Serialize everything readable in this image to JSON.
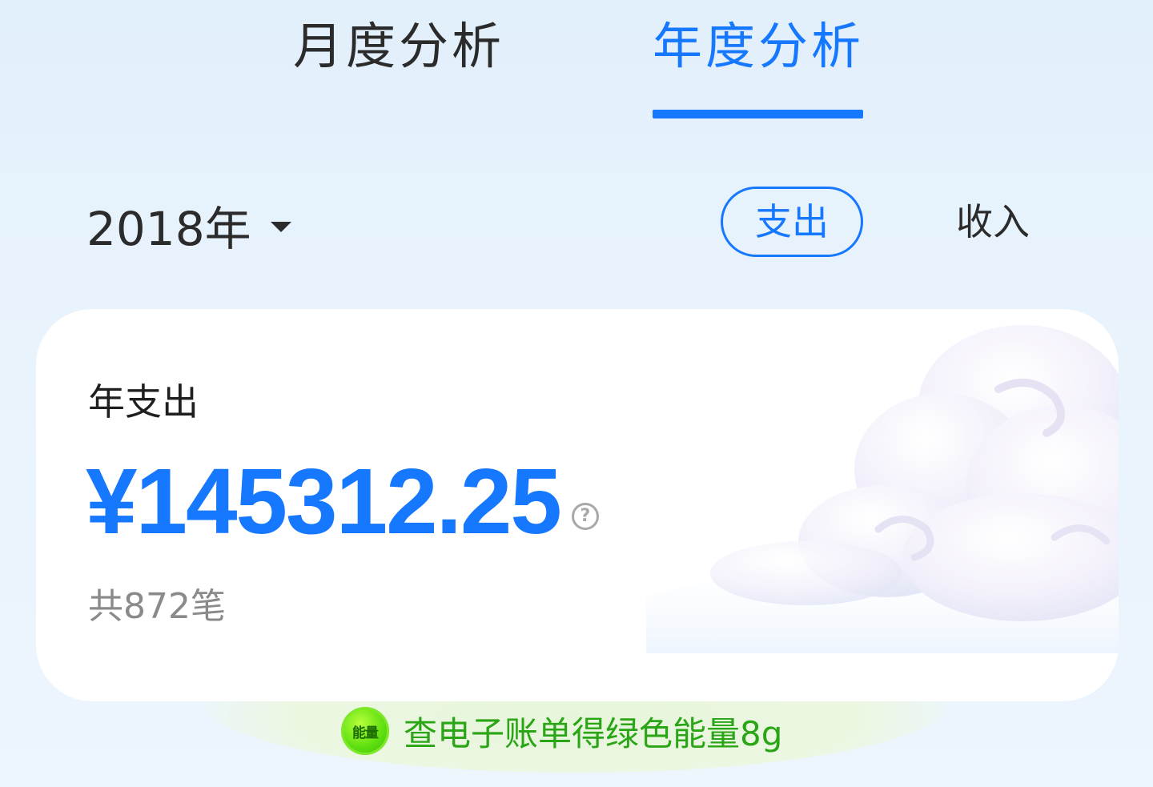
{
  "tabs": {
    "monthly": "月度分析",
    "yearly": "年度分析",
    "active": "yearly"
  },
  "filter": {
    "year": "2018年",
    "expense_label": "支出",
    "income_label": "收入",
    "selected_type": "expense"
  },
  "summary": {
    "title": "年支出",
    "amount": "¥145312.25",
    "help_glyph": "?",
    "count": "共872笔"
  },
  "energy": {
    "badge": "能量",
    "text": "查电子账单得绿色能量8g"
  },
  "colors": {
    "accent": "#1677ff",
    "text_primary": "#2b2b2b",
    "text_secondary": "#8a8a8a",
    "energy_green": "#2aa515",
    "background": "#e6f1fc"
  },
  "icons": {
    "dropdown": "caret-down-icon",
    "help": "question-circle-icon",
    "energy": "energy-badge-icon",
    "decoration": "cloud-icon"
  }
}
